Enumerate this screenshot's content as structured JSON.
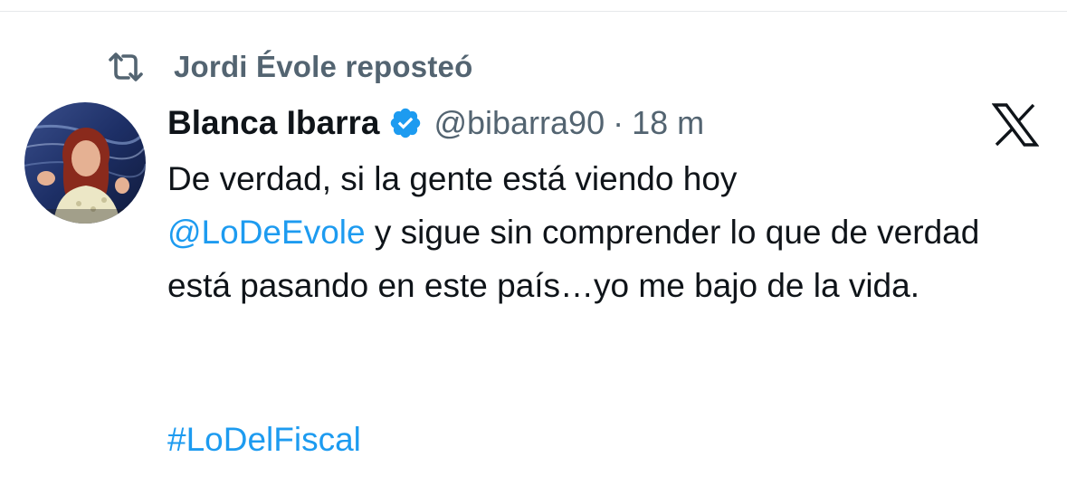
{
  "repost": {
    "icon": "repost-icon",
    "text": "Jordi Évole reposteó"
  },
  "author": {
    "name": "Blanca Ibarra",
    "verified_icon": "verified-badge-icon",
    "handle": "@bibarra90",
    "separator": "·",
    "time": "18 m"
  },
  "logo": "x-logo-icon",
  "tweet": {
    "line1": "De verdad, si la gente está viendo hoy",
    "mention": "@LoDeEvole",
    "after_mention": " y sigue sin comprender lo que de verdad está pasando en este país…yo me bajo de la vida.",
    "hashtag": "#LoDelFiscal"
  },
  "colors": {
    "link": "#1d9bf0",
    "secondary_text": "#536471",
    "primary_text": "#0f1419"
  }
}
